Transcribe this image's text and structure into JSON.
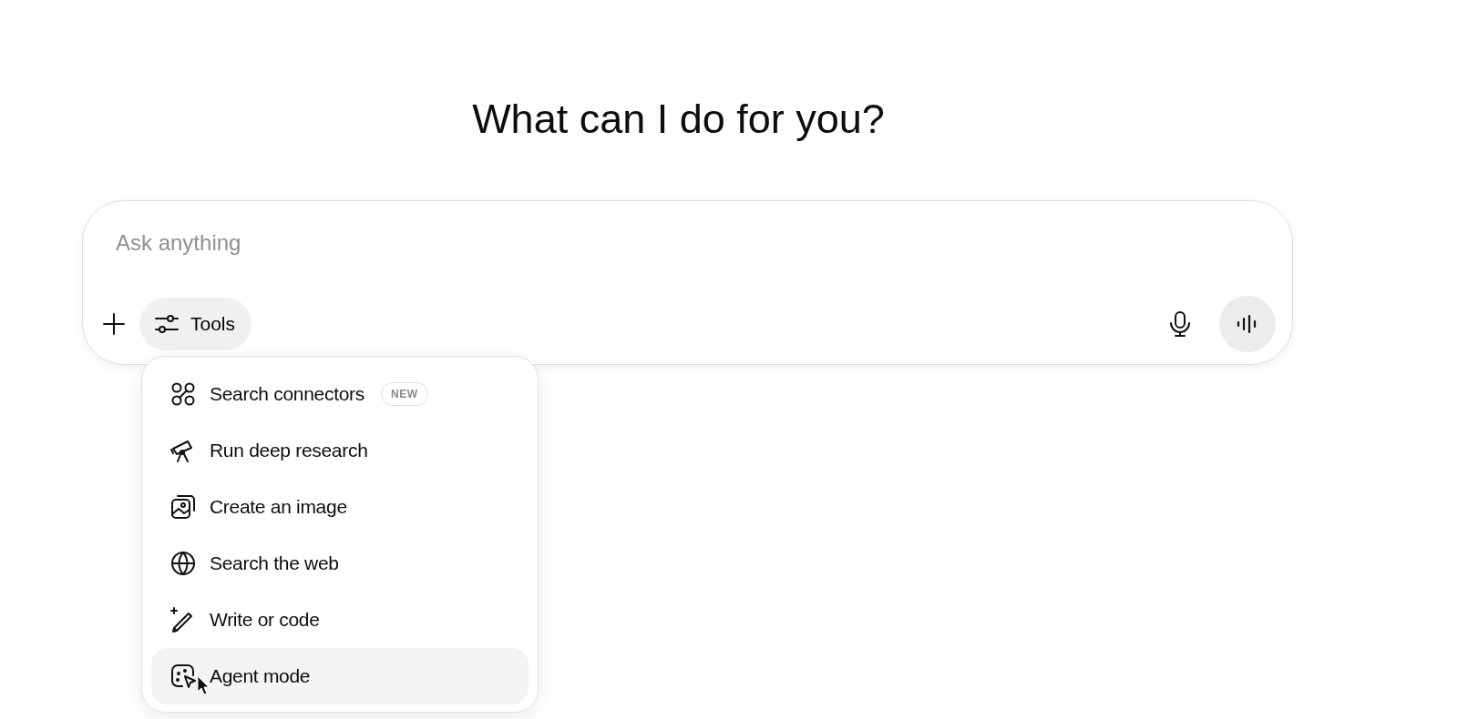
{
  "heading": "What can I do for you?",
  "composer": {
    "placeholder": "Ask anything",
    "tools_button": "Tools"
  },
  "tools_menu": [
    {
      "kind": "connectors",
      "label": "Search connectors",
      "badge": "NEW",
      "selected": false
    },
    {
      "kind": "research",
      "label": "Run deep research",
      "selected": false
    },
    {
      "kind": "image",
      "label": "Create an image",
      "selected": false
    },
    {
      "kind": "web",
      "label": "Search the web",
      "selected": false
    },
    {
      "kind": "write",
      "label": "Write or code",
      "selected": false
    },
    {
      "kind": "agent",
      "label": "Agent mode",
      "selected": true
    }
  ]
}
